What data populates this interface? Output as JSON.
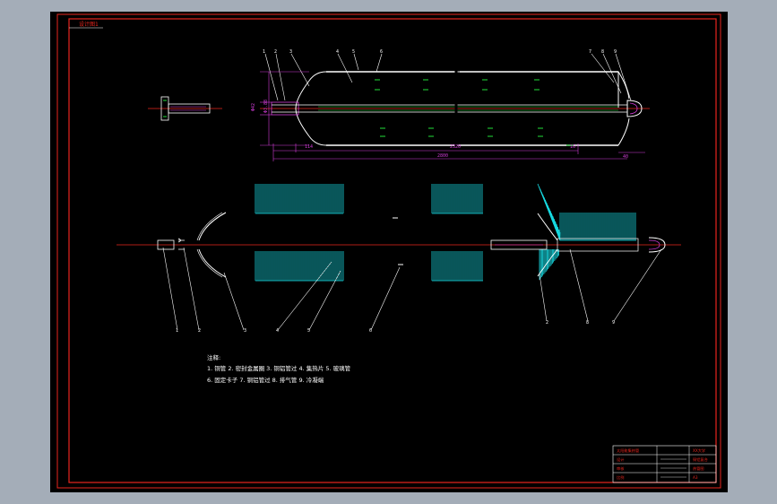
{
  "title_tag": "设计图1",
  "top_view": {
    "part_numbers": [
      "1",
      "2",
      "3",
      "4",
      "5",
      "6",
      "7",
      "8",
      "9"
    ],
    "diameter_labels": [
      "Φ42",
      "Φ3.88"
    ],
    "dimensions": {
      "left_offset": "114",
      "mid_length": "2320",
      "right_offset": "16",
      "total_length": "2800",
      "end_offset": "40"
    }
  },
  "exploded_view": {
    "part_numbers": [
      "1",
      "2",
      "3",
      "4",
      "5",
      "6",
      "2",
      "8",
      "9"
    ]
  },
  "notes": {
    "heading": "注释:",
    "line1": "1. 铜管  2. 密封金属圈  3. 铜铝管过  4. 集热片  5. 玻璃管",
    "line2": "6. 固定卡子  7. 铜铝管过  8. 排气管  9. 冷凝端"
  },
  "title_block": {
    "rows": [
      "太阳能集热管",
      "设计",
      "审核",
      "比例"
    ],
    "right_cells": [
      "XX大学",
      "铜铝复合",
      "热管图",
      "A3"
    ]
  },
  "colors": {
    "frame": "#e8261e",
    "outline": "#ffffff",
    "dimension": "#d23cd8",
    "fins": "#17d8e0",
    "hatch": "#22e03a",
    "centerline": "#e8261e"
  }
}
